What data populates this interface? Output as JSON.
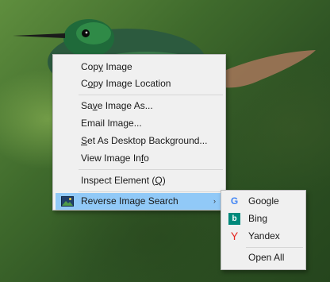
{
  "context_menu": {
    "items": [
      {
        "pre": "Cop",
        "key": "y",
        "post": " Image"
      },
      {
        "pre": "C",
        "key": "o",
        "post": "py Image Location"
      },
      {
        "pre": "Sa",
        "key": "v",
        "post": "e Image As..."
      },
      {
        "pre": "Email Ima",
        "key": "g",
        "post": "e..."
      },
      {
        "pre": "",
        "key": "S",
        "post": "et As Desktop Background..."
      },
      {
        "pre": "View Image In",
        "key": "f",
        "post": "o"
      },
      {
        "pre": "Inspect Element (",
        "key": "Q",
        "post": ")"
      },
      {
        "pre": "",
        "key": "",
        "post": "Reverse Image Search"
      }
    ],
    "submenu_arrow": "›"
  },
  "submenu": {
    "items": [
      {
        "label": "Google",
        "icon": "google-icon",
        "glyph": "G"
      },
      {
        "label": "Bing",
        "icon": "bing-icon",
        "glyph": "b"
      },
      {
        "label": "Yandex",
        "icon": "yandex-icon",
        "glyph": "Y"
      },
      {
        "label": "Open All",
        "icon": "",
        "glyph": ""
      }
    ]
  },
  "colors": {
    "highlight": "#91c9f7",
    "menu_bg": "#f0f0f0",
    "google_blue": "#4285f4",
    "bing_teal": "#00897b",
    "yandex_red": "#e52620"
  }
}
